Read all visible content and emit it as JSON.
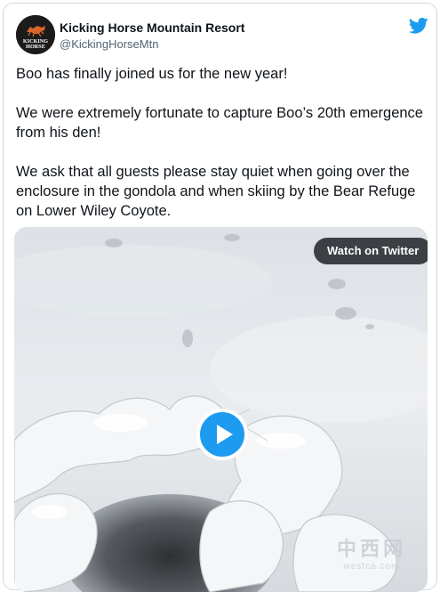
{
  "tweet": {
    "author_name": "Kicking Horse Mountain Resort",
    "author_handle": "@KickingHorseMtn",
    "avatar_text": "KICKING HORSE",
    "paragraphs": [
      "Boo has finally joined us for the new year!",
      "We were extremely fortunate to capture Boo’s 20th emergence from his den!",
      "We ask that all guests please stay quiet when going over the enclosure in the gondola and when skiing by the Bear Refuge on Lower Wiley Coyote."
    ],
    "icons": {
      "brand": "twitter-bird-icon",
      "play": "play-icon"
    }
  },
  "media": {
    "watch_label": "Watch on Twitter",
    "watermark_cn": "中西网",
    "watermark_en": "westca.com"
  },
  "colors": {
    "accent": "#1d9bf0",
    "text": "#0f1419",
    "muted": "#536471",
    "border": "#cfd9de"
  }
}
